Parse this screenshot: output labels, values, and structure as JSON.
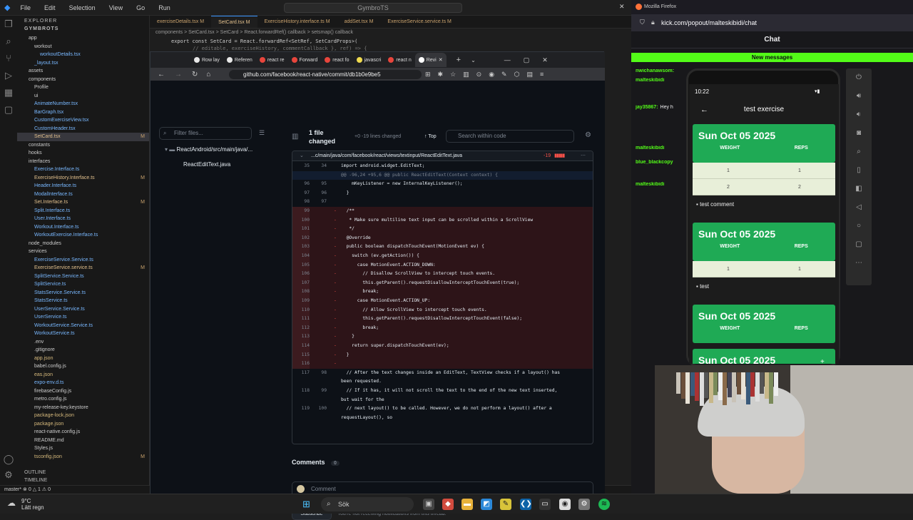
{
  "vscode": {
    "menu": [
      "File",
      "Edit",
      "Selection",
      "View",
      "Go",
      "Run"
    ],
    "search": "GymbroTS",
    "explorer_title": "EXPLORER",
    "root": "GYMBROTS",
    "tabs": [
      "exerciseDetails.tsx M",
      "SetCard.tsx M",
      "ExerciseHistory.interface.ts M",
      "addSet.tsx M",
      "ExerciseService.service.ts M"
    ],
    "breadcrumb": "components > SetCard.tsx > SetCard > React.forwardRef() callback > setsmap() callback",
    "code_line": "export const SetCard = React.forwardRef<SetRef, SetCardProps>(",
    "code_line2": "// editable, exerciseHistory, commentCallback }, ref) => {",
    "tree": [
      {
        "label": "app",
        "badge": ""
      },
      {
        "label": "workout",
        "badge": ""
      },
      {
        "label": "workoutDetails.tsx",
        "badge": ""
      },
      {
        "label": "_layout.tsx",
        "badge": ""
      },
      {
        "label": "assets",
        "badge": ""
      },
      {
        "label": "components",
        "badge": ""
      },
      {
        "label": "Profile",
        "badge": ""
      },
      {
        "label": "ui",
        "badge": ""
      },
      {
        "label": "AnimateNumber.tsx",
        "badge": ""
      },
      {
        "label": "BarGraph.tsx",
        "badge": ""
      },
      {
        "label": "CustomExerciseView.tsx",
        "badge": ""
      },
      {
        "label": "CustomHeader.tsx",
        "badge": ""
      },
      {
        "label": "SetCard.tsx",
        "badge": "M"
      },
      {
        "label": "constants",
        "badge": ""
      },
      {
        "label": "hooks",
        "badge": ""
      },
      {
        "label": "interfaces",
        "badge": ""
      },
      {
        "label": "Exercise.Interface.ts",
        "badge": ""
      },
      {
        "label": "ExerciseHistory.Interface.ts",
        "badge": "M"
      },
      {
        "label": "Header.Interface.ts",
        "badge": ""
      },
      {
        "label": "ModalInterface.ts",
        "badge": ""
      },
      {
        "label": "Set.Interface.ts",
        "badge": "M"
      },
      {
        "label": "Split.Interface.ts",
        "badge": ""
      },
      {
        "label": "User.Interface.ts",
        "badge": ""
      },
      {
        "label": "Workout.Interface.ts",
        "badge": ""
      },
      {
        "label": "WorkoutExercise.Interface.ts",
        "badge": ""
      },
      {
        "label": "node_modules",
        "badge": ""
      },
      {
        "label": "services",
        "badge": ""
      },
      {
        "label": "ExerciseService.Service.ts",
        "badge": ""
      },
      {
        "label": "ExerciseService.service.ts",
        "badge": "M"
      },
      {
        "label": "SplitService.Service.ts",
        "badge": ""
      },
      {
        "label": "SplitService.ts",
        "badge": ""
      },
      {
        "label": "StatsService.Service.ts",
        "badge": ""
      },
      {
        "label": "StatsService.ts",
        "badge": ""
      },
      {
        "label": "UserService.Service.ts",
        "badge": ""
      },
      {
        "label": "UserService.ts",
        "badge": ""
      },
      {
        "label": "WorkoutService.Service.ts",
        "badge": ""
      },
      {
        "label": "WorkoutService.ts",
        "badge": ""
      },
      {
        "label": ".env",
        "badge": ""
      },
      {
        "label": ".gitignore",
        "badge": ""
      },
      {
        "label": "app.json",
        "badge": ""
      },
      {
        "label": "babel.config.js",
        "badge": ""
      },
      {
        "label": "eas.json",
        "badge": ""
      },
      {
        "label": "expo-env.d.ts",
        "badge": ""
      },
      {
        "label": "firebaseConfig.js",
        "badge": ""
      },
      {
        "label": "metro.config.js",
        "badge": ""
      },
      {
        "label": "my-release-key.keystore",
        "badge": ""
      },
      {
        "label": "package-lock.json",
        "badge": ""
      },
      {
        "label": "package.json",
        "badge": ""
      },
      {
        "label": "react-native.config.js",
        "badge": ""
      },
      {
        "label": "README.md",
        "badge": ""
      },
      {
        "label": "Styles.js",
        "badge": ""
      },
      {
        "label": "tsconfig.json",
        "badge": "M"
      }
    ],
    "outline": "OUTLINE",
    "timeline": "TIMELINE",
    "status": "master*  ⊗ 0 △ 1 ⚠ 0"
  },
  "browser": {
    "tabs": [
      "Row lay",
      "Referen",
      "react re",
      "Forward",
      "react fo",
      "javascri",
      "react n",
      "Revi"
    ],
    "url": "github.com/facebook/react-native/commit/db1b0e9be5",
    "filter_placeholder": "Filter files...",
    "tree_folder": "ReactAndroid/src/main/java/...",
    "tree_file": "ReactEditText.java",
    "files_changed": "1 file changed",
    "lines_changed": "+0 -19  lines changed",
    "top": "Top",
    "search_code": "Search within code",
    "diff_path": "...c/main/java/com/facebook/react/views/textinput/ReactEditText.java",
    "diff_stat": "-19",
    "lines": [
      {
        "a": "35",
        "b": "34",
        "s": "",
        "t": "import android.widget.EditText;",
        "k": "ctx"
      },
      {
        "a": "",
        "b": "",
        "s": "",
        "t": "@@ -96,24 +95,6 @@ public ReactEditText(Context context) {",
        "k": "hunk"
      },
      {
        "a": "96",
        "b": "95",
        "s": "",
        "t": "    mKeyListener = new InternalKeyListener();",
        "k": "ctx"
      },
      {
        "a": "97",
        "b": "96",
        "s": "",
        "t": "  }",
        "k": "ctx"
      },
      {
        "a": "98",
        "b": "97",
        "s": "",
        "t": "",
        "k": "ctx"
      },
      {
        "a": "99",
        "b": "",
        "s": "-",
        "t": "  /**",
        "k": "del"
      },
      {
        "a": "100",
        "b": "",
        "s": "-",
        "t": "   * Make sure multiline text input can be scrolled within a ScrollView",
        "k": "del"
      },
      {
        "a": "101",
        "b": "",
        "s": "-",
        "t": "   */",
        "k": "del"
      },
      {
        "a": "102",
        "b": "",
        "s": "-",
        "t": "  @Override",
        "k": "del"
      },
      {
        "a": "103",
        "b": "",
        "s": "-",
        "t": "  public boolean dispatchTouchEvent(MotionEvent ev) {",
        "k": "del"
      },
      {
        "a": "104",
        "b": "",
        "s": "-",
        "t": "    switch (ev.getAction()) {",
        "k": "del"
      },
      {
        "a": "105",
        "b": "",
        "s": "-",
        "t": "      case MotionEvent.ACTION_DOWN:",
        "k": "del"
      },
      {
        "a": "106",
        "b": "",
        "s": "-",
        "t": "        // Disallow ScrollView to intercept touch events.",
        "k": "del"
      },
      {
        "a": "107",
        "b": "",
        "s": "-",
        "t": "        this.getParent().requestDisallowInterceptTouchEvent(true);",
        "k": "del"
      },
      {
        "a": "108",
        "b": "",
        "s": "-",
        "t": "        break;",
        "k": "del"
      },
      {
        "a": "109",
        "b": "",
        "s": "-",
        "t": "      case MotionEvent.ACTION_UP:",
        "k": "del"
      },
      {
        "a": "110",
        "b": "",
        "s": "-",
        "t": "        // Allow ScrollView to intercept touch events.",
        "k": "del"
      },
      {
        "a": "111",
        "b": "",
        "s": "-",
        "t": "        this.getParent().requestDisallowInterceptTouchEvent(false);",
        "k": "del"
      },
      {
        "a": "112",
        "b": "",
        "s": "-",
        "t": "        break;",
        "k": "del"
      },
      {
        "a": "113",
        "b": "",
        "s": "-",
        "t": "    }",
        "k": "del"
      },
      {
        "a": "114",
        "b": "",
        "s": "-",
        "t": "    return super.dispatchTouchEvent(ev);",
        "k": "del"
      },
      {
        "a": "115",
        "b": "",
        "s": "-",
        "t": "  }",
        "k": "del"
      },
      {
        "a": "116",
        "b": "",
        "s": "-",
        "t": "",
        "k": "del"
      },
      {
        "a": "117",
        "b": "98",
        "s": "",
        "t": "  // After the text changes inside an EditText, TextView checks if a layout() has",
        "k": "ctx"
      },
      {
        "a": "",
        "b": "",
        "s": "",
        "t": "been requested.",
        "k": "ctx"
      },
      {
        "a": "118",
        "b": "99",
        "s": "",
        "t": "  // If it has, it will not scroll the text to the end of the new text inserted,",
        "k": "ctx"
      },
      {
        "a": "",
        "b": "",
        "s": "",
        "t": "but wait for the",
        "k": "ctx"
      },
      {
        "a": "119",
        "b": "100",
        "s": "",
        "t": "  // next layout() to be called. However, we do not perform a layout() after a",
        "k": "ctx"
      },
      {
        "a": "",
        "b": "",
        "s": "",
        "t": "requestLayout(), so",
        "k": "ctx"
      }
    ],
    "comments": "Comments",
    "comments_count": "0",
    "comment_placeholder": "Comment",
    "subscribe": "Subscribe",
    "not_receiving": "You're not receiving notifications from this thread."
  },
  "firefox": {
    "title": "Mozilla Firefox",
    "url": "kick.com/popout/malteskibidi/chat",
    "chat": "Chat",
    "new_messages": "New messages",
    "messages": [
      {
        "user": "nwichanawsom:",
        "text": ""
      },
      {
        "user": "malteskibidi",
        "text": ""
      },
      {
        "user": "jay35867:",
        "text": "Hey h"
      },
      {
        "user": "malteskibidi",
        "text": ""
      },
      {
        "user": "blue_blackcopy",
        "text": ""
      },
      {
        "user": "malteskibidi",
        "text": ""
      }
    ]
  },
  "phone": {
    "time": "10:22",
    "title": "test exercise",
    "cards": [
      {
        "date": "Sun Oct 05 2025",
        "weight": "WEIGHT",
        "reps": "REPS",
        "rows": [
          [
            "1",
            "1"
          ],
          [
            "2",
            "2"
          ]
        ],
        "comment": "test comment"
      },
      {
        "date": "Sun Oct 05 2025",
        "weight": "WEIGHT",
        "reps": "REPS",
        "rows": [
          [
            "1",
            "1"
          ]
        ],
        "comment": "test"
      },
      {
        "date": "Sun Oct 05 2025",
        "weight": "WEIGHT",
        "reps": "REPS",
        "rows": [],
        "comment": ""
      },
      {
        "date": "Sun Oct 05 2025",
        "weight": "",
        "reps": "",
        "rows": [],
        "comment": ""
      }
    ]
  },
  "taskbar": {
    "temp": "9°C",
    "weather": "Lätt regn",
    "search": "Sök"
  }
}
